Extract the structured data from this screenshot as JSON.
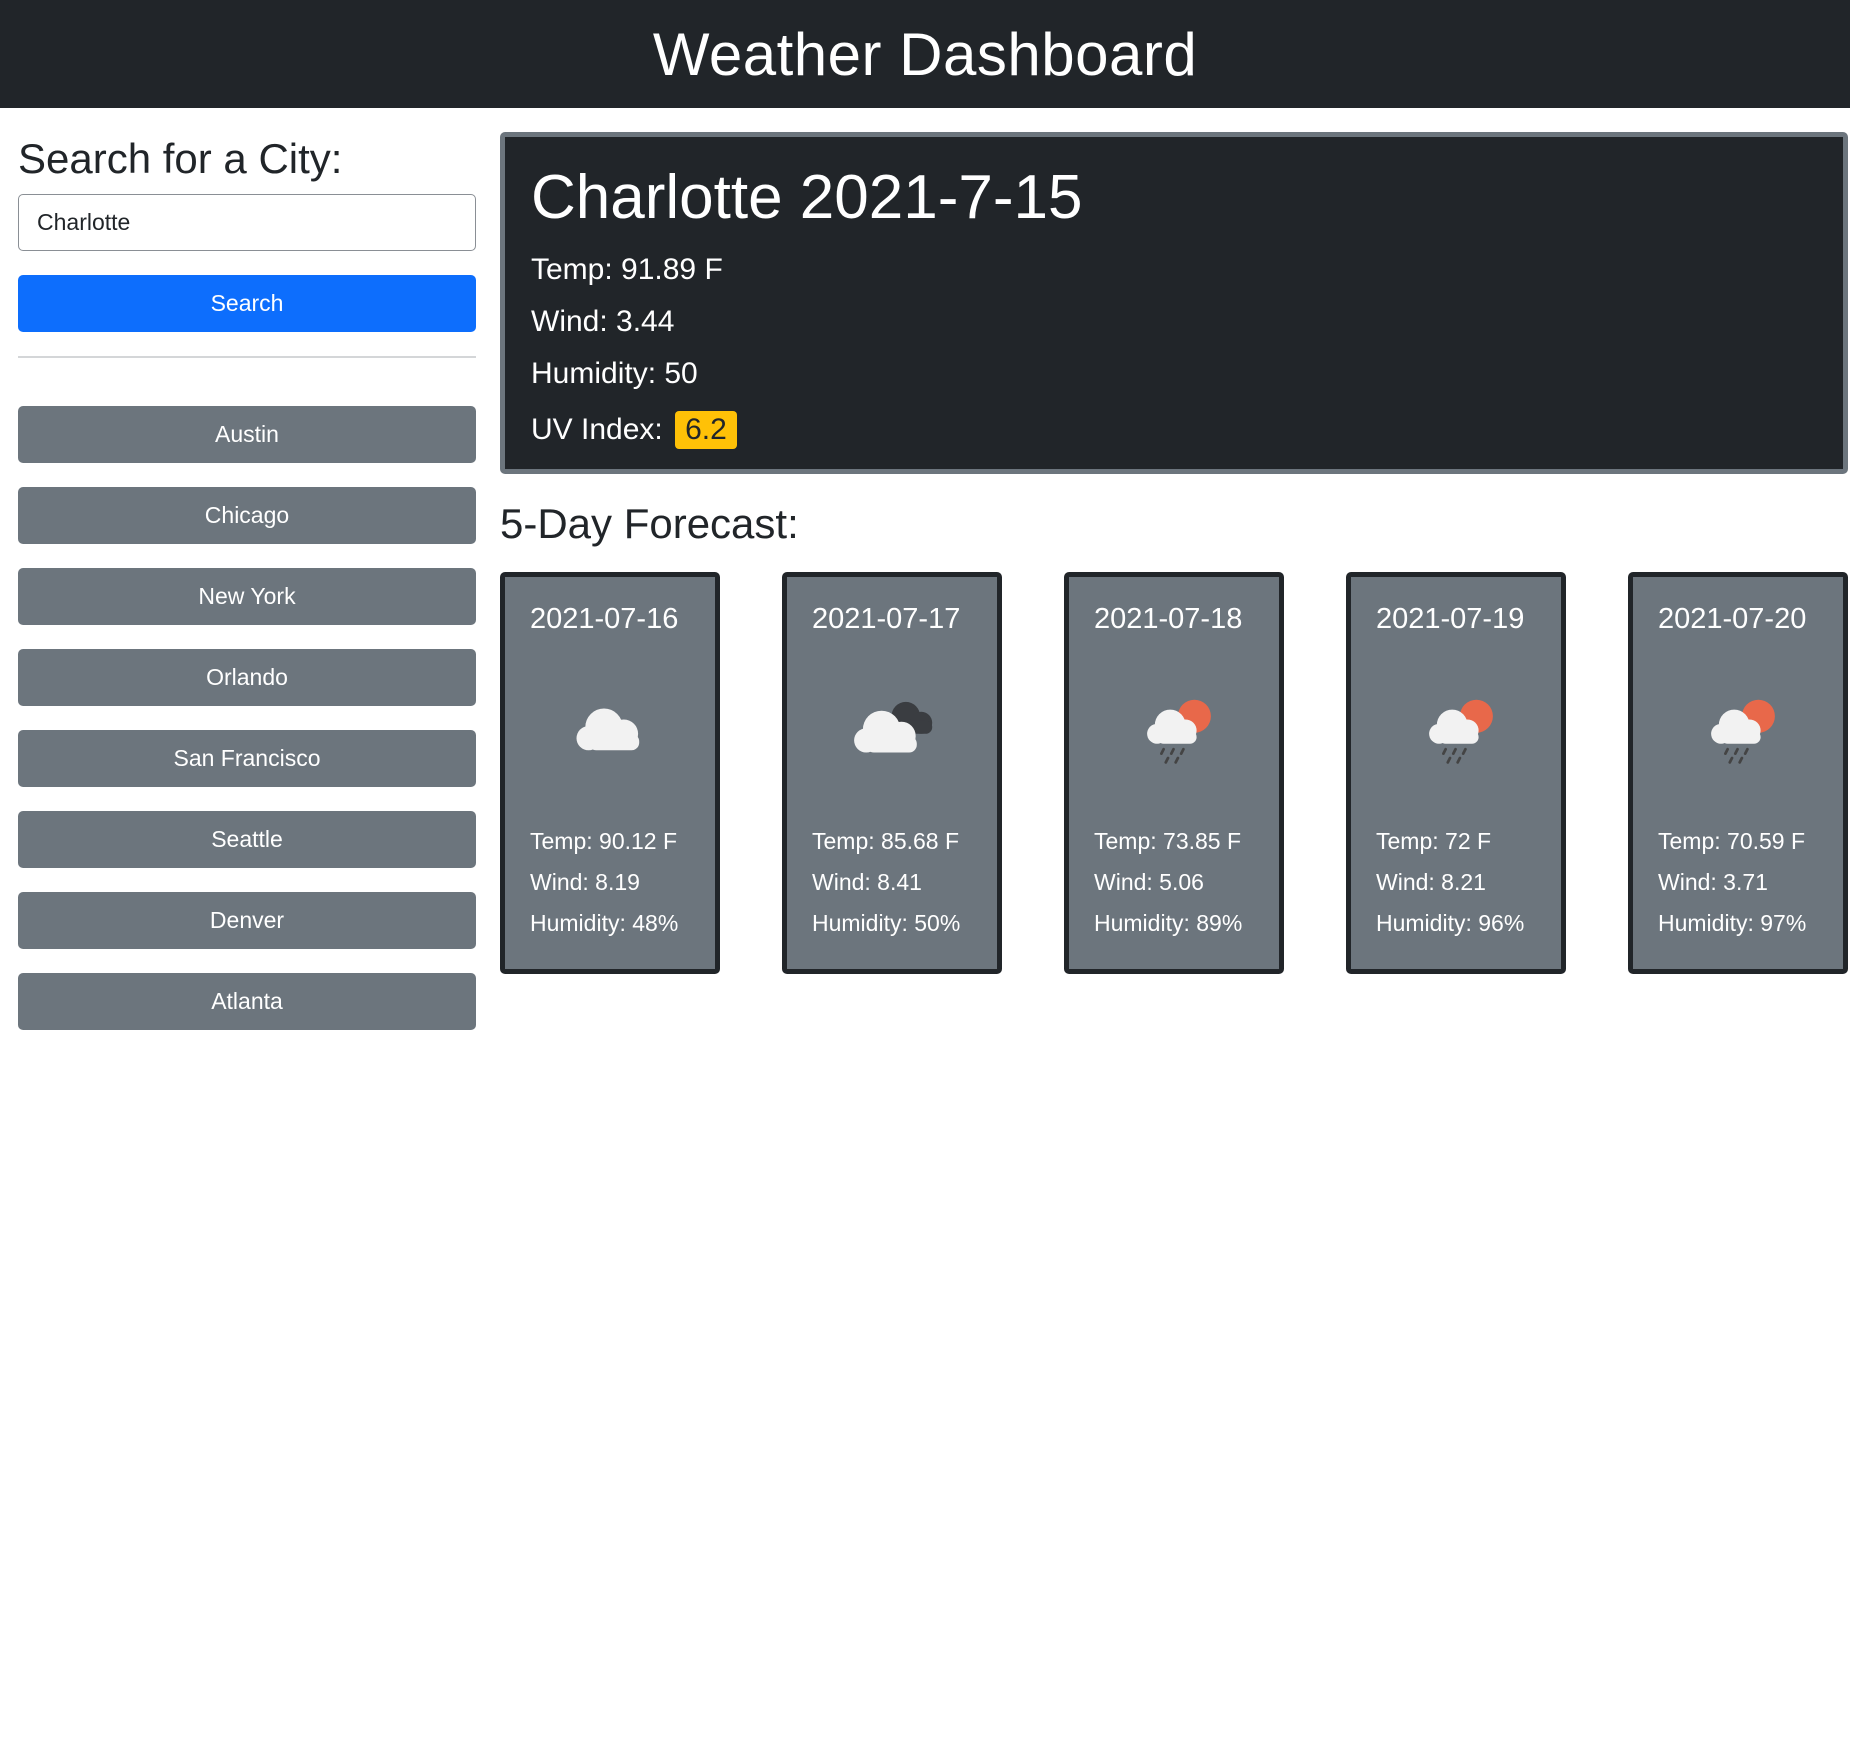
{
  "header": {
    "title": "Weather Dashboard"
  },
  "search": {
    "heading": "Search for a City:",
    "value": "Charlotte",
    "button_label": "Search"
  },
  "history": [
    "Austin",
    "Chicago",
    "New York",
    "Orlando",
    "San Francisco",
    "Seattle",
    "Denver",
    "Atlanta"
  ],
  "current": {
    "title": "Charlotte 2021-7-15",
    "temp": "Temp: 91.89 F",
    "wind": "Wind: 3.44",
    "humidity": "Humidity: 50",
    "uv_label": "UV Index:",
    "uv_value": "6.2",
    "uv_color": "#ffc107"
  },
  "forecast": {
    "heading": "5-Day Forecast:",
    "days": [
      {
        "date": "2021-07-16",
        "icon": "cloudy-icon",
        "temp": "Temp: 90.12 F",
        "wind": "Wind: 8.19",
        "humidity": "Humidity: 48%"
      },
      {
        "date": "2021-07-17",
        "icon": "overcast-clouds-icon",
        "temp": "Temp: 85.68 F",
        "wind": "Wind: 8.41",
        "humidity": "Humidity: 50%"
      },
      {
        "date": "2021-07-18",
        "icon": "rain-sun-icon",
        "temp": "Temp: 73.85 F",
        "wind": "Wind: 5.06",
        "humidity": "Humidity: 89%"
      },
      {
        "date": "2021-07-19",
        "icon": "rain-sun-icon",
        "temp": "Temp: 72 F",
        "wind": "Wind: 8.21",
        "humidity": "Humidity: 96%"
      },
      {
        "date": "2021-07-20",
        "icon": "rain-sun-icon",
        "temp": "Temp: 70.59 F",
        "wind": "Wind: 3.71",
        "humidity": "Humidity: 97%"
      }
    ]
  },
  "colors": {
    "header_bg": "#212529",
    "primary": "#0d6efd",
    "secondary": "#6c757d",
    "uv_moderate": "#ffc107"
  }
}
